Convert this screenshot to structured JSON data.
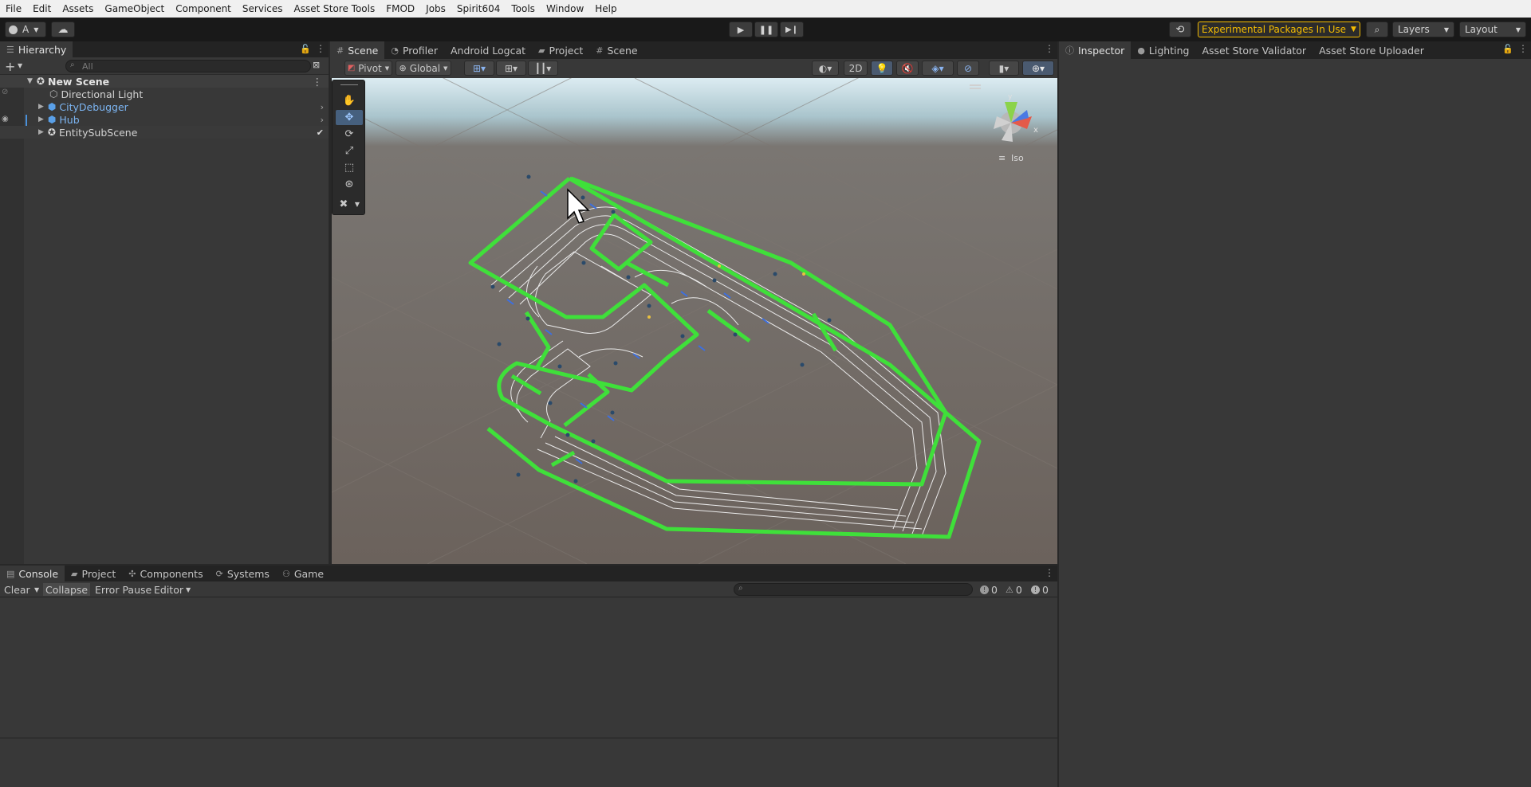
{
  "menu": [
    "File",
    "Edit",
    "Assets",
    "GameObject",
    "Component",
    "Services",
    "Asset Store Tools",
    "FMOD",
    "Jobs",
    "Spirit604",
    "Tools",
    "Window",
    "Help"
  ],
  "toolbar": {
    "account_label": "A",
    "experimental_label": "Experimental Packages In Use",
    "layers_label": "Layers",
    "layout_label": "Layout",
    "accent_color": "#f4bc02"
  },
  "hierarchy": {
    "tab_label": "Hierarchy",
    "search_placeholder": "All",
    "scene_name": "New Scene",
    "items": [
      {
        "label": "Directional Light",
        "kind": "gameobject"
      },
      {
        "label": "CityDebugger",
        "kind": "prefab"
      },
      {
        "label": "Hub",
        "kind": "prefab"
      },
      {
        "label": "EntitySubScene",
        "kind": "subscene"
      }
    ]
  },
  "center_tabs": [
    "Scene",
    "Profiler",
    "Android Logcat",
    "Project",
    "Scene"
  ],
  "scene_toolbar": {
    "pivot_label": "Pivot",
    "global_label": "Global",
    "two_d_label": "2D",
    "iso_label": "Iso",
    "axis_x": "x",
    "axis_y": "y"
  },
  "inspector_tabs": [
    "Inspector",
    "Lighting",
    "Asset Store Validator",
    "Asset Store Uploader"
  ],
  "bottom_tabs": [
    "Console",
    "Project",
    "Components",
    "Systems",
    "Game"
  ],
  "console": {
    "clear_label": "Clear",
    "collapse_label": "Collapse",
    "error_pause_label": "Error Pause",
    "editor_label": "Editor",
    "log_count": "0",
    "warn_count": "0",
    "error_count": "0"
  }
}
